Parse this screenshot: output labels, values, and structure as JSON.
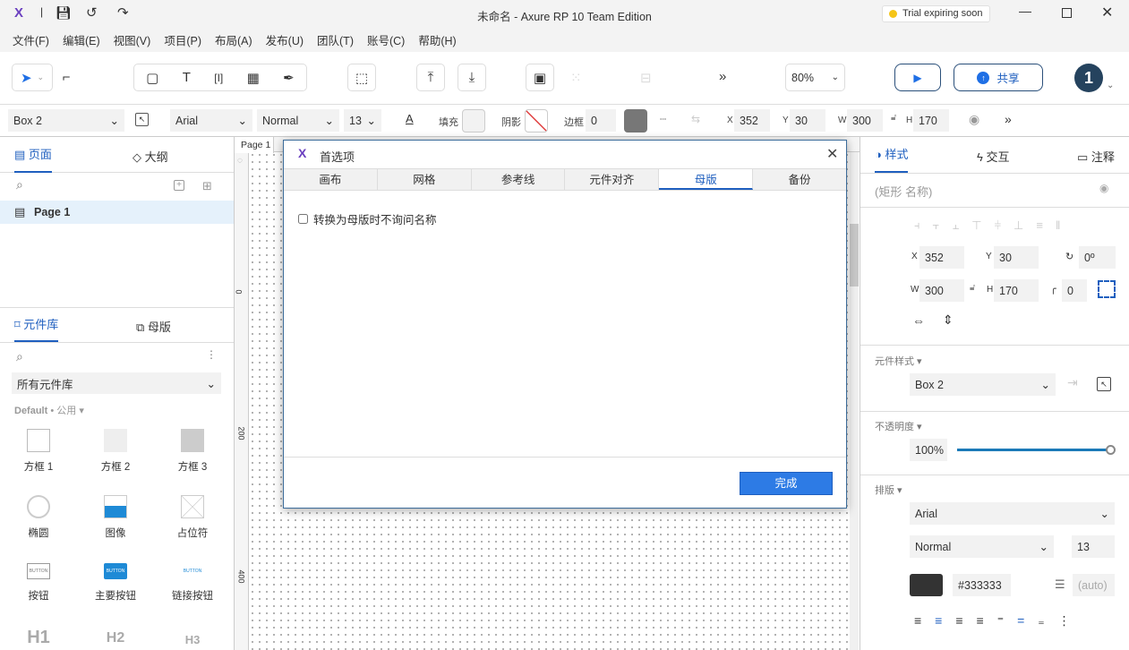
{
  "window": {
    "title": "未命名 - Axure RP 10 Team Edition",
    "trial": "Trial expiring soon",
    "logo": "X"
  },
  "menu": [
    "文件(F)",
    "编辑(E)",
    "视图(V)",
    "项目(P)",
    "布局(A)",
    "发布(U)",
    "团队(T)",
    "账号(C)",
    "帮助(H)"
  ],
  "toolbar": {
    "more": "»",
    "zoom": "80%",
    "share": "共享",
    "avatar": "1"
  },
  "format": {
    "style": "Box 2",
    "font": "Arial",
    "weight": "Normal",
    "size": "13",
    "fill_label": "填充",
    "shadow_label": "阴影",
    "border_label": "边框",
    "border": "0",
    "x_label": "X",
    "x": "352",
    "y_label": "Y",
    "y": "30",
    "w_label": "W",
    "w": "300",
    "h_label": "H",
    "h": "170",
    "more": "»"
  },
  "left": {
    "tab_pages": "页面",
    "tab_outline": "大纲",
    "page": "Page 1",
    "tab_library": "元件库",
    "tab_masters": "母版",
    "library_select": "所有元件库",
    "group": "Default",
    "group_sub": "公用",
    "widgets": [
      "方框 1",
      "方框 2",
      "方框 3",
      "椭圆",
      "图像",
      "占位符",
      "按钮",
      "主要按钮",
      "链接按钮",
      "H1",
      "H2",
      "H3"
    ],
    "button_text": "BUTTON"
  },
  "canvas": {
    "page_tab": "Page 1",
    "ruler": [
      "0",
      "200",
      "400"
    ]
  },
  "dialog": {
    "title": "首选项",
    "tabs": [
      "画布",
      "网格",
      "参考线",
      "元件对齐",
      "母版",
      "备份"
    ],
    "active_tab": 4,
    "option": "转换为母版时不询问名称",
    "option_checked": false,
    "done": "完成"
  },
  "right": {
    "tab_style": "样式",
    "tab_interact": "交互",
    "tab_notes": "注释",
    "name_placeholder": "(矩形 名称)",
    "x_label": "X",
    "x": "352",
    "y_label": "Y",
    "y": "30",
    "rot": "0º",
    "w_label": "W",
    "w": "300",
    "h_label": "H",
    "h": "170",
    "radius": "0",
    "widget_style_label": "元件样式",
    "widget_style": "Box 2",
    "opacity_label": "不透明度",
    "opacity": "100%",
    "opacity_value": 100,
    "typography_label": "排版",
    "font": "Arial",
    "weight": "Normal",
    "size": "13",
    "color": "#333333",
    "line_height": "(auto)"
  },
  "colors": {
    "accent": "#1f5fbf",
    "button": "#2d7be5",
    "selected_row": "#e5f1fb"
  }
}
